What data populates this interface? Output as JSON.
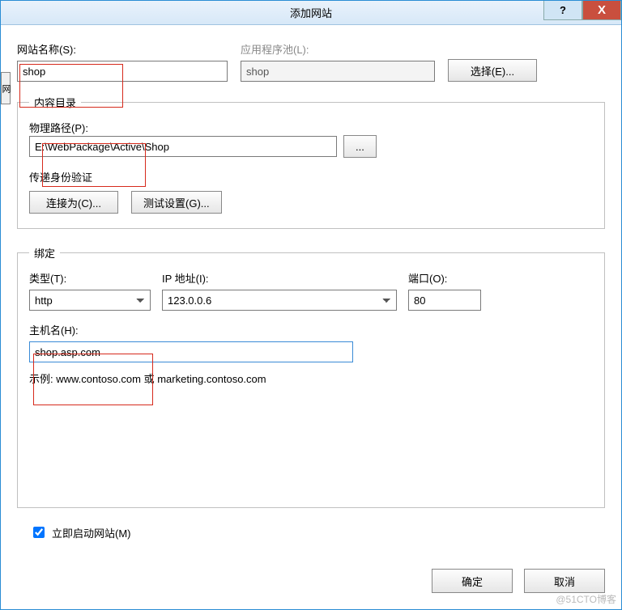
{
  "window": {
    "title": "添加网站"
  },
  "site_name": {
    "label": "网站名称(S):",
    "value": "shop"
  },
  "app_pool": {
    "label": "应用程序池(L):",
    "value": "shop",
    "select_btn": "选择(E)..."
  },
  "content_dir": {
    "legend": "内容目录",
    "physical_path_label": "物理路径(P):",
    "physical_path_value": "E:\\WebPackage\\Active\\Shop",
    "browse_btn": "...",
    "auth_label": "传递身份验证",
    "connect_as_btn": "连接为(C)...",
    "test_btn": "测试设置(G)..."
  },
  "binding": {
    "legend": "绑定",
    "type_label": "类型(T):",
    "type_value": "http",
    "ip_label": "IP 地址(I):",
    "ip_value": "123.0.0.6",
    "port_label": "端口(O):",
    "port_value": "80",
    "host_label": "主机名(H):",
    "host_value": "shop.asp.com",
    "example": "示例: www.contoso.com 或 marketing.contoso.com"
  },
  "start_checkbox": {
    "label": "立即启动网站(M)",
    "checked": true
  },
  "footer": {
    "ok": "确定",
    "cancel": "取消"
  },
  "left_tab": "网",
  "watermark": "@51CTO博客"
}
